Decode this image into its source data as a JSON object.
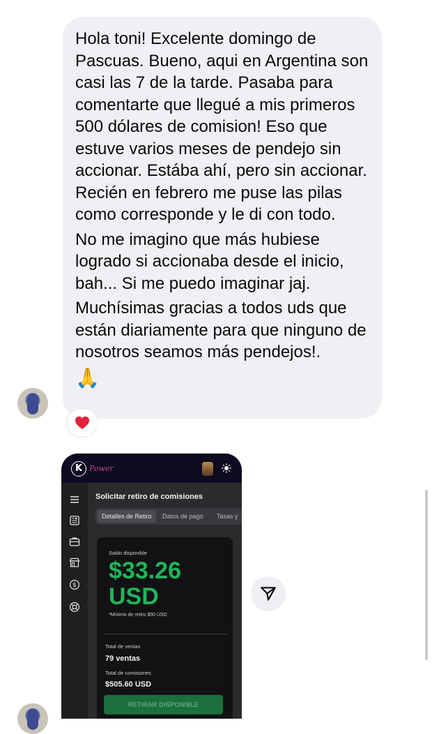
{
  "message": {
    "paragraphs": [
      "Hola toni! Excelente domingo de Pascuas. Bueno, aqui en Argentina son casi las 7 de la tarde. Pasaba para comentarte que llegué a mis primeros 500 dólares de comision! Eso que estuve varios meses de pendejo sin accionar. Estába ahí, pero sin accionar. Recién en febrero me puse las pilas como corresponde y le di con todo.",
      "No me imagino que más hubiese logrado si accionaba desde el inicio, bah... Si me puedo imaginar jaj.",
      "Muchísimas gracias a todos uds que están diariamente para que ninguno de nosotros seamos más pendejos!."
    ],
    "emoji": "🙏",
    "reaction_emoji": "❤️"
  },
  "screenshot": {
    "brand": "Power",
    "section_title": "Solicitar retiro de comisiones",
    "tabs": [
      "Detalles de Retiro",
      "Datos de pago",
      "Tasas y"
    ],
    "balance_label": "Saldo disponible",
    "balance_amount": "$33.26",
    "balance_currency": "USD",
    "min_note": "*Mínimo de retiro $50 USD",
    "sales_label": "Total de ventas",
    "sales_value": "79 ventas",
    "commissions_label": "Total de comisiones",
    "commissions_value": "$505.60 USD",
    "withdraw_button": "RETIRAR DISPONIBLE"
  },
  "colors": {
    "bubble": "#efeff4",
    "balance_green": "#22b45a",
    "button_green": "#1c6f3c",
    "header_navy": "#0d0b22"
  }
}
